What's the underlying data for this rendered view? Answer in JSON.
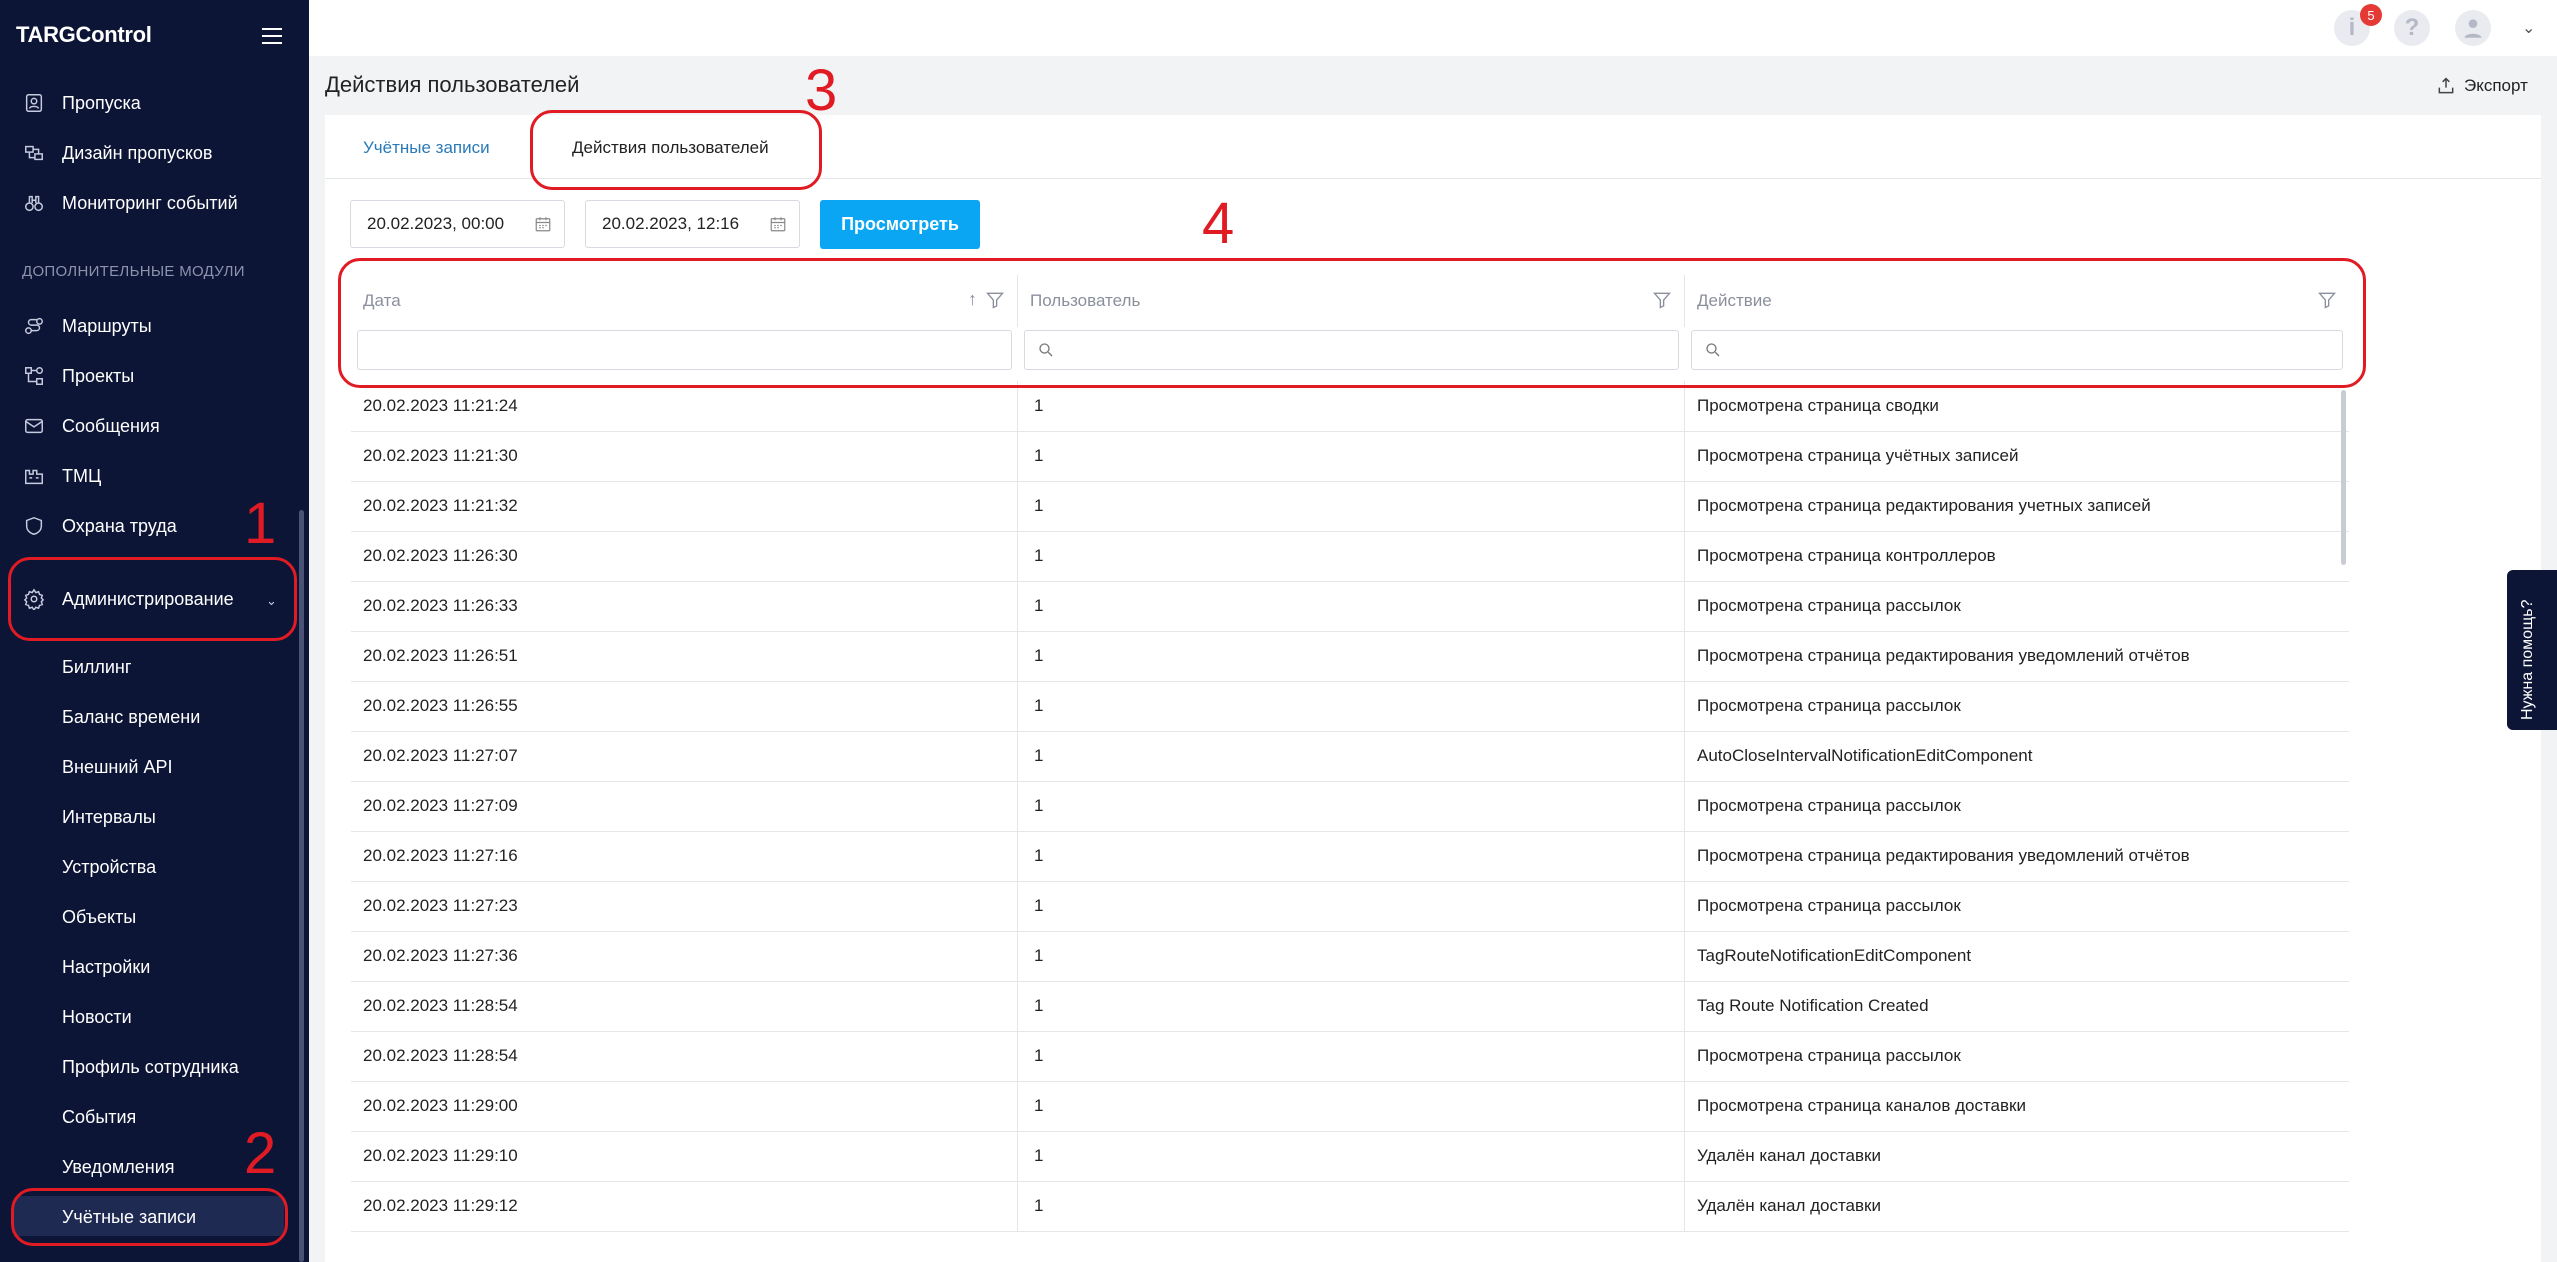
{
  "app": {
    "logo": "TARGControl"
  },
  "sidebar": {
    "main_items": [
      {
        "label": "Пропуска",
        "icon": "badge-icon"
      },
      {
        "label": "Дизайн пропусков",
        "icon": "design-icon"
      },
      {
        "label": "Мониторинг событий",
        "icon": "binoculars-icon"
      }
    ],
    "section_label": "ДОПОЛНИТЕЛЬНЫЕ МОДУЛИ",
    "module_items": [
      {
        "label": "Маршруты",
        "icon": "route-icon"
      },
      {
        "label": "Проекты",
        "icon": "project-icon"
      },
      {
        "label": "Сообщения",
        "icon": "mail-icon"
      },
      {
        "label": "ТМЦ",
        "icon": "warehouse-icon"
      },
      {
        "label": "Охрана труда",
        "icon": "shield-icon"
      }
    ],
    "admin": {
      "label": "Администрирование",
      "icon": "gear-icon"
    },
    "admin_items": [
      "Биллинг",
      "Баланс времени",
      "Внешний API",
      "Интервалы",
      "Устройства",
      "Объекты",
      "Настройки",
      "Новости",
      "Профиль сотрудника",
      "События",
      "Уведомления",
      "Учётные записи"
    ]
  },
  "topbar": {
    "notification_count": "5",
    "info_glyph": "i",
    "help_glyph": "?"
  },
  "header": {
    "title": "Действия пользователей",
    "export_label": "Экспорт"
  },
  "tabs": [
    {
      "label": "Учётные записи"
    },
    {
      "label": "Действия пользователей"
    }
  ],
  "filters": {
    "date_from": "20.02.2023, 00:00",
    "date_to": "20.02.2023, 12:16",
    "view_button": "Просмотреть"
  },
  "table": {
    "columns": [
      "Дата",
      "Пользователь",
      "Действие"
    ],
    "sort_glyph": "↑",
    "rows": [
      [
        "20.02.2023 11:21:24",
        "1",
        "Просмотрена страница сводки"
      ],
      [
        "20.02.2023 11:21:30",
        "1",
        "Просмотрена страница учётных записей"
      ],
      [
        "20.02.2023 11:21:32",
        "1",
        "Просмотрена страница редактирования учетных записей"
      ],
      [
        "20.02.2023 11:26:30",
        "1",
        "Просмотрена страница контроллеров"
      ],
      [
        "20.02.2023 11:26:33",
        "1",
        "Просмотрена страница рассылок"
      ],
      [
        "20.02.2023 11:26:51",
        "1",
        "Просмотрена страница редактирования уведомлений отчётов"
      ],
      [
        "20.02.2023 11:26:55",
        "1",
        "Просмотрена страница рассылок"
      ],
      [
        "20.02.2023 11:27:07",
        "1",
        "AutoCloseIntervalNotificationEditComponent"
      ],
      [
        "20.02.2023 11:27:09",
        "1",
        "Просмотрена страница рассылок"
      ],
      [
        "20.02.2023 11:27:16",
        "1",
        "Просмотрена страница редактирования уведомлений отчётов"
      ],
      [
        "20.02.2023 11:27:23",
        "1",
        "Просмотрена страница рассылок"
      ],
      [
        "20.02.2023 11:27:36",
        "1",
        "TagRouteNotificationEditComponent"
      ],
      [
        "20.02.2023 11:28:54",
        "1",
        "Tag Route Notification Created"
      ],
      [
        "20.02.2023 11:28:54",
        "1",
        "Просмотрена страница рассылок"
      ],
      [
        "20.02.2023 11:29:00",
        "1",
        "Просмотрена страница каналов доставки"
      ],
      [
        "20.02.2023 11:29:10",
        "1",
        "Удалён канал доставки"
      ],
      [
        "20.02.2023 11:29:12",
        "1",
        "Удалён канал доставки"
      ]
    ]
  },
  "help_tab": {
    "label": "Нужна помощь?"
  },
  "annotations": [
    "1",
    "2",
    "3",
    "4"
  ],
  "colors": {
    "sidebar_bg": "#0d1536",
    "accent": "#0aa6f4",
    "annotation": "#e01b24",
    "tab_link": "#2a7ab9"
  }
}
